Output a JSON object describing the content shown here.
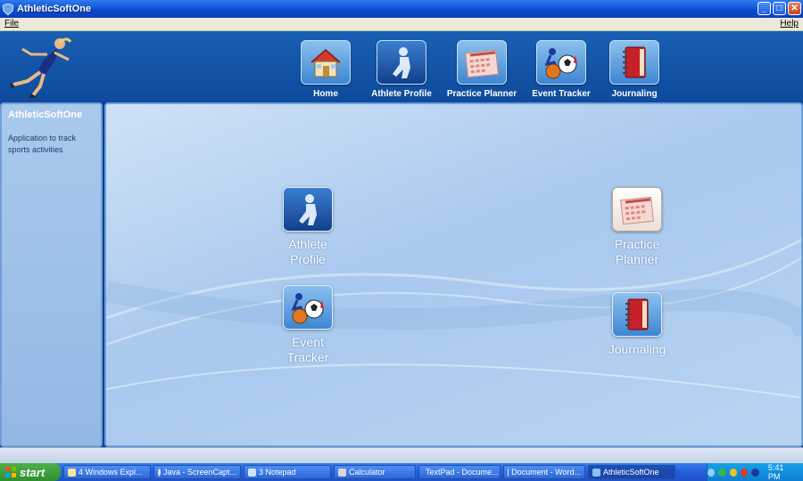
{
  "window": {
    "title": "AthleticSoftOne"
  },
  "menu": {
    "file": "File",
    "help": "Help"
  },
  "nav": [
    {
      "label": "Home",
      "icon": "house-icon"
    },
    {
      "label": "Athlete Profile",
      "icon": "athlete-silhouette-icon"
    },
    {
      "label": "Practice Planner",
      "icon": "calendar-icon"
    },
    {
      "label": "Event Tracker",
      "icon": "sports-balls-icon"
    },
    {
      "label": "Journaling",
      "icon": "notebook-icon"
    }
  ],
  "sidebar": {
    "title": "AthleticSoftOne",
    "description": "Application to track sports activities"
  },
  "tiles": [
    {
      "label_line1": "Athlete",
      "label_line2": "Profile",
      "icon": "athlete-silhouette-icon"
    },
    {
      "label_line1": "Practice",
      "label_line2": "Planner",
      "icon": "calendar-icon"
    },
    {
      "label_line1": "Event",
      "label_line2": "Tracker",
      "icon": "sports-balls-icon"
    },
    {
      "label_line1": "Journaling",
      "label_line2": "",
      "icon": "notebook-icon"
    }
  ],
  "taskbar": {
    "start": "start",
    "tasks": [
      {
        "label": "4 Windows Expl..."
      },
      {
        "label": "Java - ScreenCapt..."
      },
      {
        "label": "3 Notepad"
      },
      {
        "label": "Calculator"
      },
      {
        "label": "TextPad - Docume..."
      },
      {
        "label": "Document - Word..."
      },
      {
        "label": "AthleticSoftOne"
      }
    ],
    "clock": "5:41 PM"
  },
  "colors": {
    "accent": "#0d4a9c",
    "panel": "#a8c8ee"
  }
}
